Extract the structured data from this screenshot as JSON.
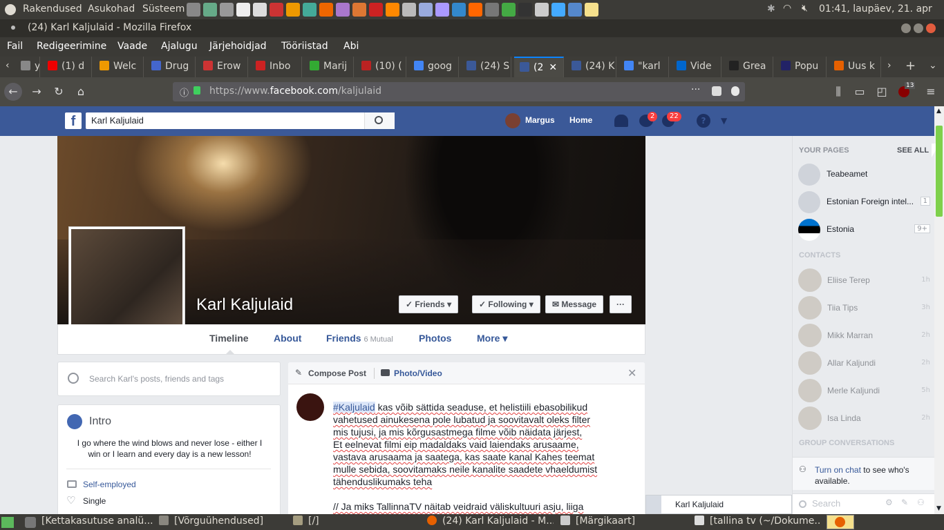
{
  "system": {
    "menus": [
      "Rakendused",
      "Asukohad",
      "Süsteem"
    ],
    "clock": "01:41, laupäev, 21. apr",
    "tray_colors": [
      "#888",
      "#6a8",
      "#999",
      "#eee",
      "#ddd",
      "#c33",
      "#e90",
      "#4a9",
      "#e60",
      "#a7c",
      "#d73",
      "#c22",
      "#f80",
      "#bbb",
      "#9ad",
      "#a9f",
      "#38c",
      "#f60",
      "#777",
      "#4a4",
      "#333",
      "#ccc",
      "#4af",
      "#58c",
      "#f5e08c"
    ]
  },
  "window": {
    "title": "(24) Karl Kaljulaid - Mozilla Firefox"
  },
  "menubar": [
    "Fail",
    "Redigeerimine",
    "Vaade",
    "Ajalugu",
    "Järjehoidjad",
    "Tööriistad",
    "Abi"
  ],
  "tabs": [
    {
      "label": "ycl",
      "color": "#888"
    },
    {
      "label": "(1) d",
      "color": "#e00"
    },
    {
      "label": "Welc",
      "color": "#e90"
    },
    {
      "label": "Drug",
      "color": "#46c"
    },
    {
      "label": "Erow",
      "color": "#c33"
    },
    {
      "label": "Inbo",
      "color": "#c22"
    },
    {
      "label": "Marij",
      "color": "#3a3"
    },
    {
      "label": "(10) (",
      "color": "#b22"
    },
    {
      "label": "goog",
      "color": "#4285f4"
    },
    {
      "label": "(24) S",
      "color": "#3b5998"
    },
    {
      "label": "(2",
      "color": "#3b5998"
    },
    {
      "label": "(24) K",
      "color": "#3b5998"
    },
    {
      "label": "\"karl",
      "color": "#4285f4"
    },
    {
      "label": "Vide",
      "color": "#06c"
    },
    {
      "label": "Grea",
      "color": "#222"
    },
    {
      "label": "Popu",
      "color": "#226"
    },
    {
      "label": "Uus k",
      "color": "#e66000"
    }
  ],
  "nav": {
    "url_prefix": "https://www.",
    "url_domain": "facebook.com",
    "url_path": "/kaljulaid",
    "ext_badge": "13"
  },
  "facebook": {
    "search_value": "Karl Kaljulaid",
    "user_name": "Margus",
    "home_label": "Home",
    "messages_badge": "2",
    "notifications_badge": "22"
  },
  "profile": {
    "name": "Karl Kaljulaid",
    "buttons": [
      "Friends",
      "Following",
      "Message"
    ],
    "more_dots": "···",
    "tabs": {
      "timeline": "Timeline",
      "about": "About",
      "friends": "Friends",
      "mutual": "6 Mutual",
      "photos": "Photos",
      "more": "More"
    },
    "search_placeholder": "Search Karl's posts, friends and tags",
    "intro_title": "Intro",
    "intro_text": "I go where the wind blows and never lose - either I win or I learn and every day is a new lesson!",
    "occupation": "Self-employed",
    "relationship": "Single"
  },
  "compose": {
    "tab_post": "Compose Post",
    "tab_photo": "Photo/Video",
    "hashtag": "#Kaljulaid",
    "lines": [
      " kas võib sättida seaduse, et helistiili ebasobilikud",
      "vahetused ainukesena pole lubatud ja soovitavalt oleks filter",
      "mis tujusi, ja mis kõrgusastmega filme võib näidata järjest,",
      "Et eelnevat filmi eip madaldaks vaid laiendaks arusaame,",
      "vastava arusaama ja saatega, kas saate kanal Kahes teemat",
      "mulle sebida, soovitamaks neile kanalite saadete vhaeldumist",
      "tähenduslikumaks teha"
    ],
    "line_after": "// Ja miks TallinnaTV näitab veidraid väliskultuuri asju, liiga"
  },
  "sidebar": {
    "your_pages": "YOUR PAGES",
    "see_all": "SEE ALL",
    "pages": [
      {
        "name": "Teabeamet",
        "badge": ""
      },
      {
        "name": "Estonian Foreign intel...",
        "badge": "1"
      },
      {
        "name": "Estonia",
        "badge": "9+"
      }
    ],
    "contacts_title": "CONTACTS",
    "contacts": [
      {
        "name": "Eliise Terep",
        "time": "1h"
      },
      {
        "name": "Tiia Tips",
        "time": "3h"
      },
      {
        "name": "Mikk Marran",
        "time": "2h"
      },
      {
        "name": "Allar Kaljundi",
        "time": "2h"
      },
      {
        "name": "Merle Kaljundi",
        "time": "5h"
      },
      {
        "name": "Isa Linda",
        "time": "2h"
      }
    ],
    "group_title": "GROUP CONVERSATIONS",
    "chat_link": "Turn on chat",
    "chat_text": " to see who's available.",
    "search_placeholder": "Search",
    "chat_tab_name": "Karl Kaljulaid"
  },
  "taskbar": [
    {
      "label": "[Kettakasutuse analü..."
    },
    {
      "label": "[Võrguühendused]"
    },
    {
      "label": "[/]"
    },
    {
      "label": "(24) Karl Kaljulaid - M..."
    },
    {
      "label": "[Märgikaart]"
    },
    {
      "label": "[tallina tv (~/Dokume..."
    }
  ]
}
